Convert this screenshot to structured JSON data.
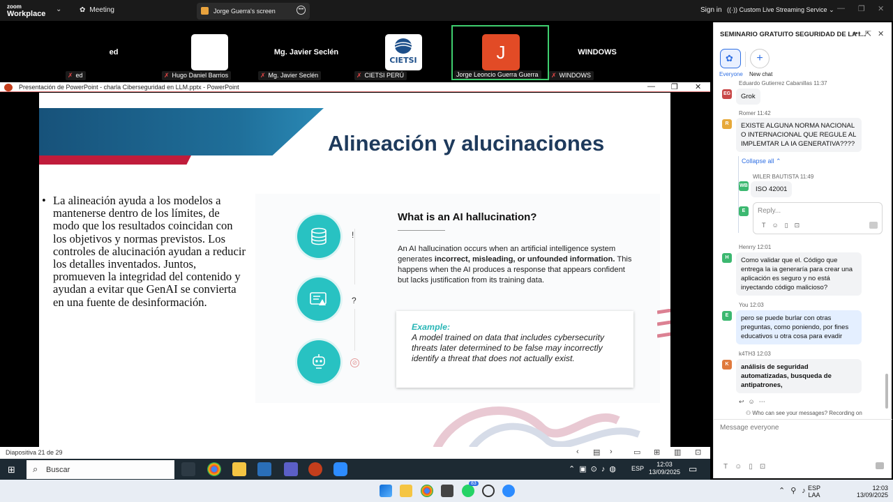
{
  "zoom_bar": {
    "brand_small": "zoom",
    "brand": "Workplace",
    "meeting": "Meeting",
    "share_tab": "Jorge Guerra's screen",
    "sign_in": "Sign in",
    "streaming": "Custom Live Streaming Service"
  },
  "gallery": [
    {
      "display": "ed",
      "caption": "ed"
    },
    {
      "display": "",
      "caption": "Hugo Daniel Barrios"
    },
    {
      "display": "Mg. Javier Seclén",
      "caption": "Mg. Javier Seclén"
    },
    {
      "display": "CIETSI",
      "caption": "CIETSI PERÚ"
    },
    {
      "display": "J",
      "caption": "Jorge Leoncio Guerra Guerra"
    },
    {
      "display": "WINDOWS",
      "caption": "WINDOWS"
    }
  ],
  "ppt": {
    "title": "Presentación de PowerPoint  -  charla Ciberseguridad en LLM.pptx  -  PowerPoint",
    "status": "Diapositiva 21 de 29"
  },
  "slide": {
    "title": "Alineación y alucinaciones",
    "bullet": "La alineación ayuda a los modelos a mantenerse dentro de los límites, de modo que los resultados coincidan con los objetivos y normas previstos. Los controles de alucinación ayudan a reducir los detalles inventados. Juntos, promueven la integridad del contenido y ayudan a evitar que GenAI se convierta en una fuente de desinformación.",
    "heading": "What is an AI hallucination?",
    "desc_a": "An AI hallucination occurs when an artificial intelligence system generates ",
    "desc_b": "incorrect, misleading, or unfounded information.",
    "desc_c": " This happens when the AI produces a response that appears confident but lacks justification from its training data.",
    "example_label": "Example:",
    "example_text": "A model trained on data that includes cybersecurity threats later determined to be false may incorrectly identify a threat that does not actually exist.",
    "marks": [
      "!",
      "?"
    ]
  },
  "taskbar": {
    "search": "Buscar",
    "lang": "ESP",
    "time": "12:03",
    "date": "13/09/2025"
  },
  "footer": {
    "lang1": "ESP",
    "lang2": "LAA",
    "time": "12:03",
    "date": "13/09/2025",
    "whatsapp_badge": "83"
  },
  "chat": {
    "title": "SEMINARIO GRATUITO SEGURIDAD DE LA I...",
    "tab_everyone": "Everyone",
    "tab_new": "New chat",
    "messages": [
      {
        "initials": "EG",
        "author": "Eduardo Gutierrez Cabanillas",
        "time": "11:37",
        "text": "Grok"
      },
      {
        "initials": "R",
        "author": "Romer",
        "time": "11:42",
        "text": "EXISTE ALGUNA NORMA NACIONAL O INTERNACIONAL QUE REGULE AL IMPLEMTAR LA IA GENERATIVA????"
      },
      {
        "initials": "WB",
        "author": "WILER BAUTISTA",
        "time": "11:49",
        "text": "ISO 42001"
      },
      {
        "initials": "H",
        "author": "Henrry",
        "time": "12:01",
        "text": "Como validar que el. Código que entrega la ia generaría para crear una aplicación es seguro y no está inyectando código malicioso?"
      },
      {
        "initials": "E",
        "author": "You",
        "time": "12:03",
        "text": "pero se puede burlar con otras preguntas, como poniendo, por fines educativos u otra cosa para evadir"
      },
      {
        "initials": "K",
        "author": "k4TH3",
        "time": "12:03",
        "text": "análisis de seguridad automatizadas, busqueda de antipatrones,"
      }
    ],
    "collapse": "Collapse all",
    "reply_placeholder": "Reply...",
    "reply_avatar": "E",
    "who_can_see": "Who can see your messages? Recording on",
    "input_placeholder": "Message everyone"
  }
}
